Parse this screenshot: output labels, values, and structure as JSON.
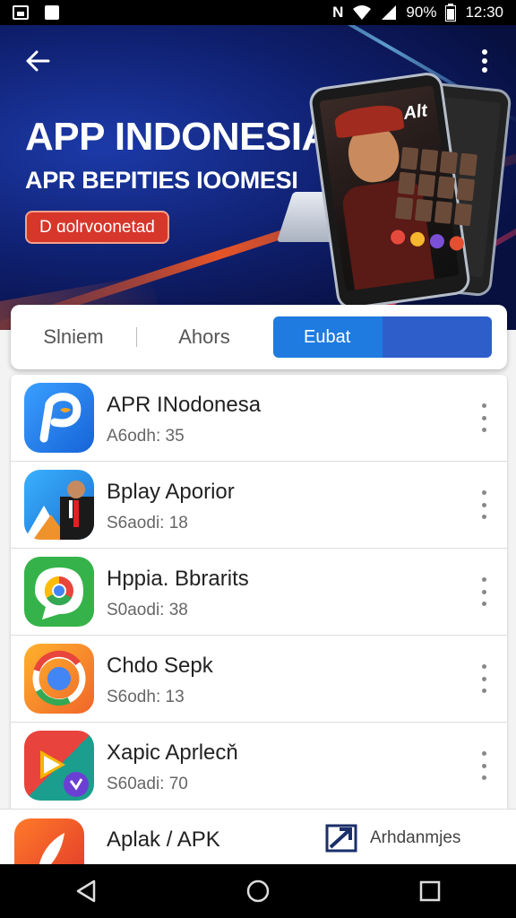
{
  "status_bar": {
    "left_icons": [
      "gallery-icon",
      "notification-icon"
    ],
    "nfc": "N",
    "battery": "90%",
    "time": "12:30"
  },
  "hero": {
    "title": "APP INDONESIA",
    "subtitle": "APR BEPITIES IOOMESI",
    "badge": "D ɑolrvoonetad",
    "device_logo": "Alt",
    "colors": {
      "bg": "#0f1f6e",
      "accent": "#ff5a1f",
      "badge": "#d7362b"
    }
  },
  "tabs": [
    {
      "label": "Slniem"
    },
    {
      "label": "Ahors"
    },
    {
      "label": "Eubat",
      "active": true
    }
  ],
  "apps": [
    {
      "title": "APR INodonesa",
      "subtitle": "A6odh: 35",
      "icon": "app-p-icon"
    },
    {
      "title": "Bplay Aporior",
      "subtitle": "S6aodi: 18",
      "icon": "app-person-icon"
    },
    {
      "title": "Hppia. Bbrarits",
      "subtitle": "S0aodi: 38",
      "icon": "chrome-bubble-icon"
    },
    {
      "title": "Chdo Sepk",
      "subtitle": "S6odh: 13",
      "icon": "chrome-ring-icon"
    },
    {
      "title": "Xapic Aprlecň",
      "subtitle": "S60adi: 70",
      "icon": "play-arrow-icon"
    }
  ],
  "bottom_bar": {
    "title": "Aplak / APK",
    "action_label": "Arhdanmjes",
    "icon": "rocket-icon",
    "action_icon": "export-icon"
  },
  "nav": {
    "back": "back-triangle-icon",
    "home": "home-circle-icon",
    "recents": "recents-square-icon"
  }
}
